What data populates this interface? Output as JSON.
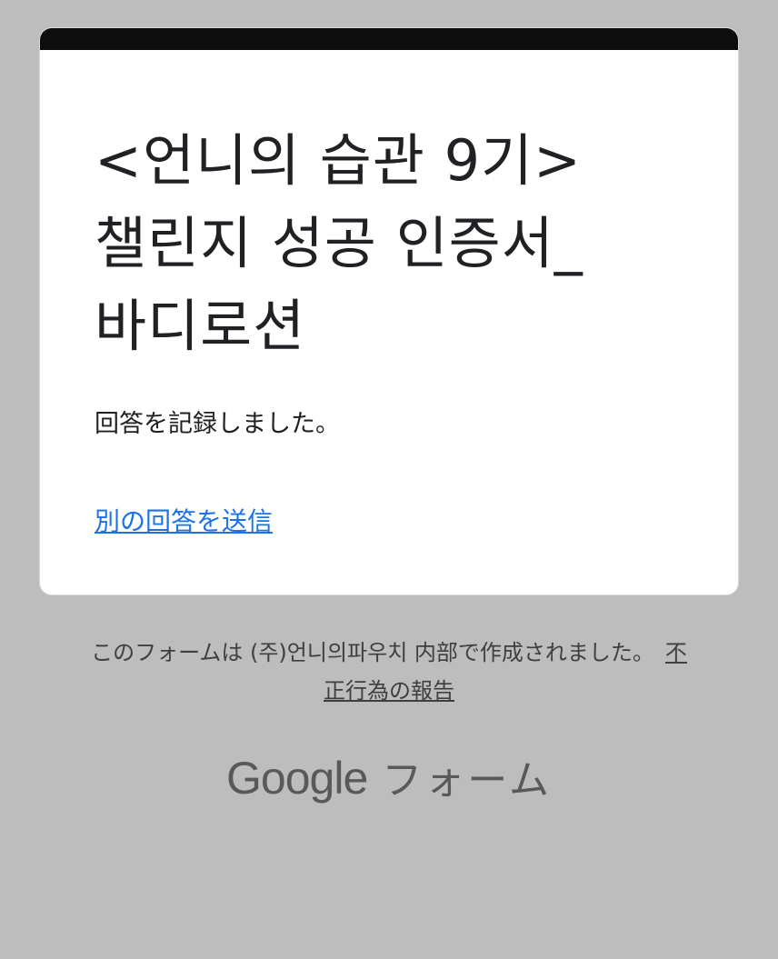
{
  "form": {
    "title_line1": "<언니의 습관 9기>",
    "title_line2": "챌린지 성공 인증서_",
    "title_line3": "바디로션",
    "confirmation": "回答を記録しました。",
    "another_response_link": "別の回答を送信"
  },
  "footer": {
    "text": "このフォームは (주)언니의파우치 内部で作成されました。",
    "abuse_link": "不正行為の報告"
  },
  "brand": {
    "google": "Google",
    "forms": "フォーム"
  },
  "colors": {
    "background": "#bdbdbd",
    "card": "#ffffff",
    "card_top_bar": "#0d0d0d",
    "link": "#1a73e8"
  }
}
